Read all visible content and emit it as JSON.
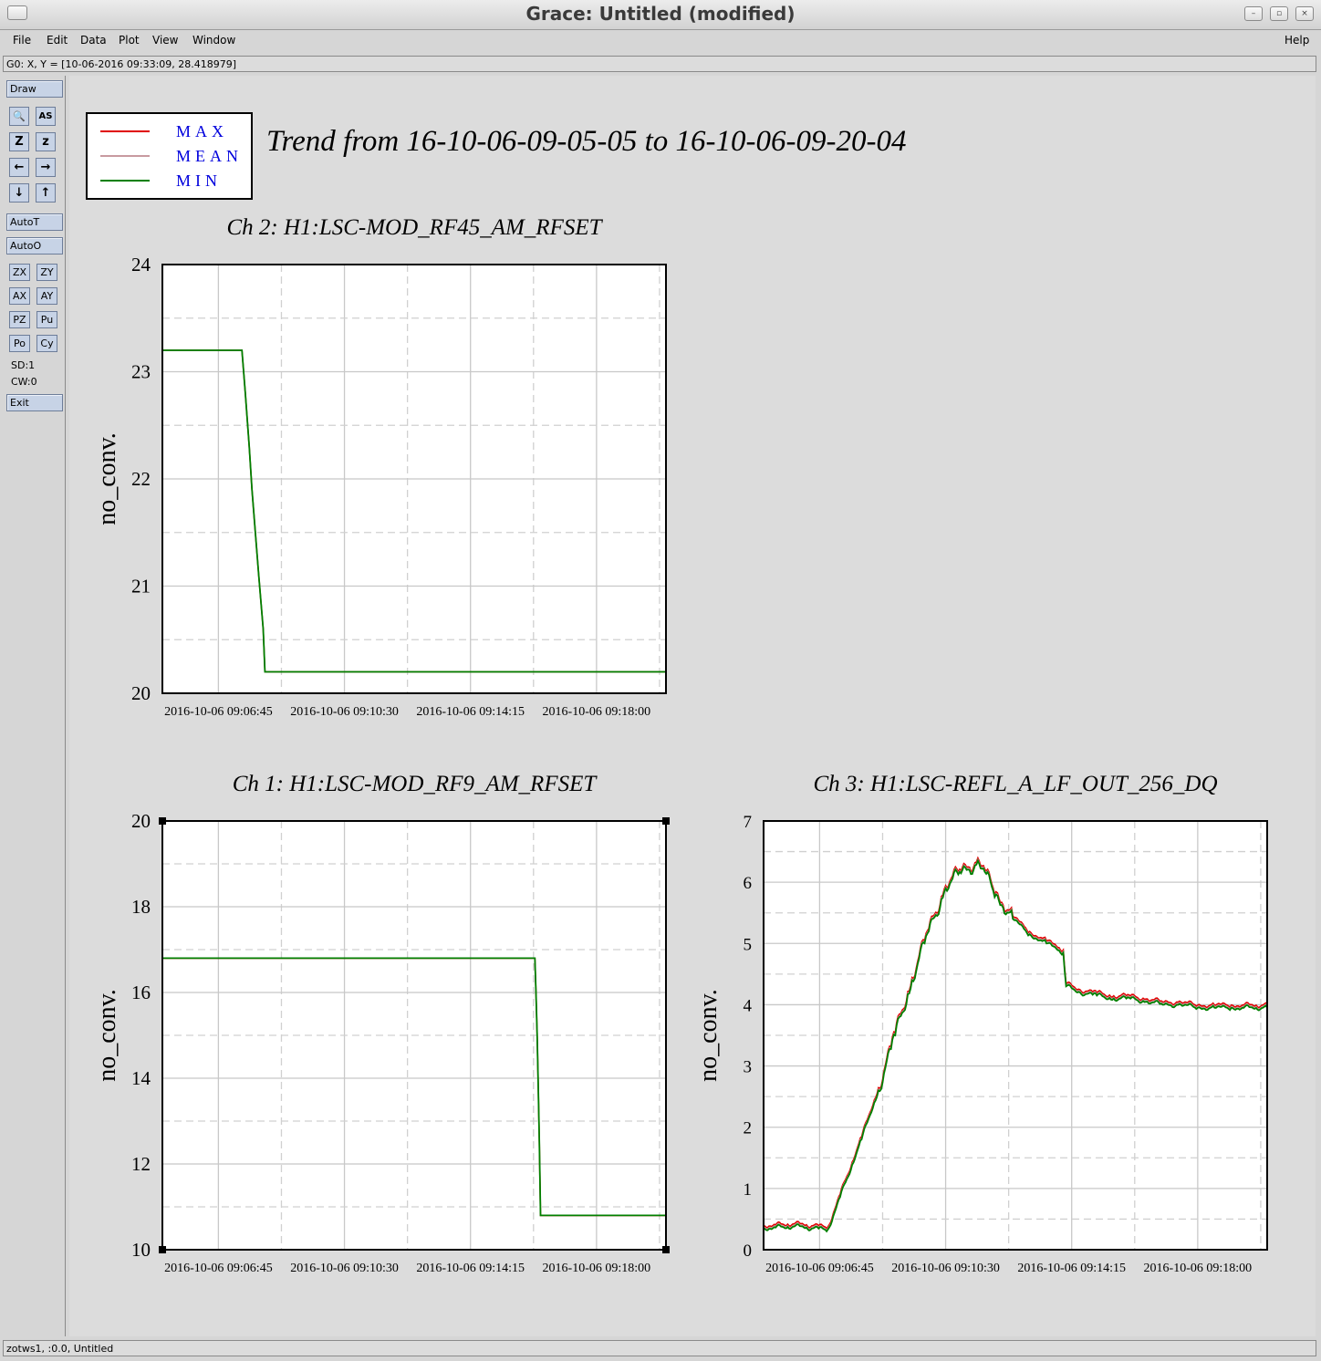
{
  "window": {
    "title": "Grace: Untitled (modified)",
    "buttons": [
      "–",
      "▫",
      "×"
    ]
  },
  "menu": {
    "left": [
      "File",
      "Edit",
      "Data",
      "Plot",
      "View",
      "Window"
    ],
    "help": "Help"
  },
  "coords_text": "G0: X, Y = [10-06-2016 09:33:09, 28.418979]",
  "toolbar": {
    "draw": "Draw",
    "icon_buttons": [
      {
        "glyph": "🔍",
        "name": "zoom-icon"
      },
      {
        "glyph": "AS",
        "name": "autoscale-icon"
      },
      {
        "glyph": "Z",
        "name": "zoom-in-icon"
      },
      {
        "glyph": "z",
        "name": "zoom-out-icon"
      },
      {
        "glyph": "←",
        "name": "arrow-left-icon"
      },
      {
        "glyph": "→",
        "name": "arrow-right-icon"
      },
      {
        "glyph": "↓",
        "name": "arrow-down-icon"
      },
      {
        "glyph": "↑",
        "name": "arrow-up-icon"
      }
    ],
    "autot": "AutoT",
    "autoo": "AutoO",
    "small_buttons": [
      "ZX",
      "ZY",
      "AX",
      "AY",
      "PZ",
      "Pu",
      "Po",
      "Cy"
    ],
    "sd": "SD:1",
    "cw": "CW:0",
    "exit": "Exit"
  },
  "status_text": "zotws1, :0.0, Untitled",
  "legend": [
    {
      "label": "MAX",
      "color": "#e00000"
    },
    {
      "label": "MEAN",
      "color": "#c89aa0"
    },
    {
      "label": "MIN",
      "color": "#008000"
    }
  ],
  "legend_text_color": "#0000dd",
  "page_title": "Trend from 16-10-06-09-05-05 to 16-10-06-09-20-04",
  "chart_data": [
    {
      "type": "line",
      "title": "Ch 2: H1:LSC-MOD_RF45_AM_RFSET",
      "ylabel": "no_conv.",
      "ylim": [
        20,
        24
      ],
      "yticks": [
        "20",
        "21",
        "22",
        "23",
        "24"
      ],
      "xticks": [
        "2016-10-06 09:06:45",
        "2016-10-06 09:10:30",
        "2016-10-06 09:14:15",
        "2016-10-06 09:18:00"
      ],
      "xlim": [
        "09:05:05",
        "09:20:04"
      ],
      "series": [
        {
          "name": "MIN",
          "x": [
            "09:05:05",
            "09:07:27",
            "09:07:33",
            "09:07:40",
            "09:07:45",
            "09:07:51",
            "09:07:57",
            "09:08:05",
            "09:08:08",
            "09:20:04"
          ],
          "y": [
            23.2,
            23.2,
            22.8,
            22.3,
            21.9,
            21.5,
            21.1,
            20.6,
            20.2,
            20.2
          ]
        }
      ]
    },
    {
      "type": "line",
      "title": "Ch 1: H1:LSC-MOD_RF9_AM_RFSET",
      "ylabel": "no_conv.",
      "ylim": [
        10,
        20
      ],
      "yticks": [
        "10",
        "12",
        "14",
        "16",
        "18",
        "20"
      ],
      "xticks": [
        "2016-10-06 09:06:45",
        "2016-10-06 09:10:30",
        "2016-10-06 09:14:15",
        "2016-10-06 09:18:00"
      ],
      "xlim": [
        "09:05:05",
        "09:20:04"
      ],
      "series": [
        {
          "name": "MIN",
          "x": [
            "09:05:05",
            "09:16:10",
            "09:16:12",
            "09:16:14",
            "09:16:16",
            "09:16:18",
            "09:16:20",
            "09:20:04"
          ],
          "y": [
            16.8,
            16.8,
            16.0,
            15.0,
            13.8,
            12.5,
            10.8,
            10.8
          ]
        }
      ]
    },
    {
      "type": "line",
      "title": "Ch 3: H1:LSC-REFL_A_LF_OUT_256_DQ",
      "ylabel": "no_conv.",
      "ylim": [
        0,
        7
      ],
      "yticks": [
        "0",
        "1",
        "2",
        "3",
        "4",
        "5",
        "6",
        "7"
      ],
      "xticks": [
        "2016-10-06 09:06:45",
        "2016-10-06 09:10:30",
        "2016-10-06 09:14:15",
        "2016-10-06 09:18:00"
      ],
      "xlim": [
        "09:05:05",
        "09:20:04"
      ],
      "series": [
        {
          "name": "MIN",
          "x": [
            "09:05:05",
            "09:06:00",
            "09:07:00",
            "09:08:00",
            "09:08:30",
            "09:09:00",
            "09:09:30",
            "09:10:00",
            "09:10:30",
            "09:11:00",
            "09:11:30",
            "09:12:00",
            "09:12:30",
            "09:13:00",
            "09:13:30",
            "09:14:00",
            "09:14:05",
            "09:14:30",
            "09:15:00",
            "09:15:30",
            "09:16:00",
            "09:16:30",
            "09:17:00",
            "09:17:30",
            "09:18:00",
            "09:18:30",
            "09:19:00",
            "09:20:04"
          ],
          "y": [
            0.35,
            0.38,
            0.33,
            1.8,
            2.6,
            3.5,
            4.4,
            5.2,
            5.9,
            6.2,
            6.3,
            5.8,
            5.4,
            5.15,
            5.0,
            4.85,
            4.3,
            4.2,
            4.15,
            4.1,
            4.1,
            4.05,
            4.0,
            4.0,
            3.95,
            3.95,
            3.95,
            3.95
          ]
        }
      ]
    }
  ]
}
